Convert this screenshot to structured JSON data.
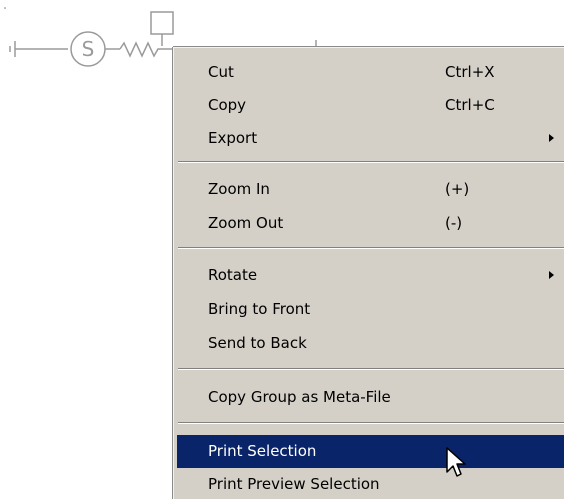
{
  "colors": {
    "menu_background": "#d4d0c8",
    "selection_background": "#0a246a",
    "selection_text": "#ffffff",
    "diagram_stroke": "#9a9a9a"
  },
  "diagram": {
    "icons": [
      "ground-symbol-icon",
      "source-circle-icon",
      "resistor-icon",
      "component-box-icon"
    ],
    "source_symbol": "S"
  },
  "context_menu": {
    "items": [
      {
        "label": "Cut",
        "shortcut": "Ctrl+X"
      },
      {
        "label": "Copy",
        "shortcut": "Ctrl+C"
      },
      {
        "label": "Export",
        "submenu": true
      },
      {
        "label": "Zoom In",
        "shortcut": "(+)"
      },
      {
        "label": "Zoom Out",
        "shortcut": "(-)"
      },
      {
        "label": "Rotate",
        "submenu": true
      },
      {
        "label": "Bring to Front"
      },
      {
        "label": "Send to Back"
      },
      {
        "label": "Copy Group as Meta-File"
      },
      {
        "label": "Print Selection",
        "selected": true
      },
      {
        "label": "Print Preview Selection"
      }
    ]
  },
  "cursor": {
    "icon": "arrow-cursor-icon"
  }
}
